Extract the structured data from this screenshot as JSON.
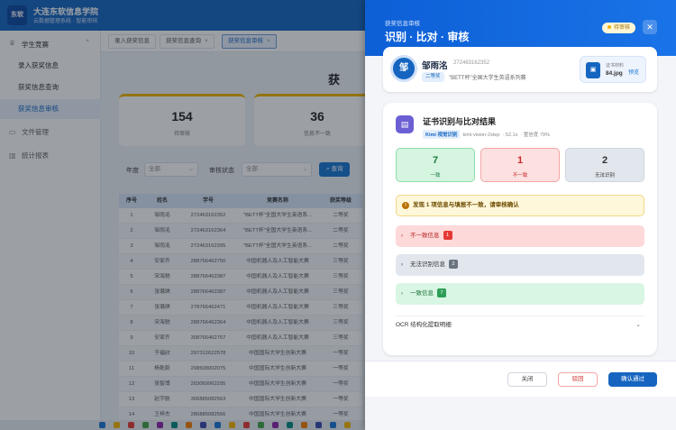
{
  "app": {
    "logo_text": "东软",
    "title": "大连东软信息学院",
    "subtitle": "云数据管理系统 · 智能审核"
  },
  "sidebar": {
    "group": {
      "label": "学生竞赛",
      "icon": "trophy-icon"
    },
    "items": [
      {
        "label": "录入获奖信息"
      },
      {
        "label": "获奖信息查询"
      },
      {
        "label": "获奖信息审核"
      }
    ],
    "groups2": [
      {
        "label": "文件管理",
        "icon": "folder-icon"
      },
      {
        "label": "统计报表",
        "icon": "chart-icon"
      }
    ]
  },
  "tabs": [
    {
      "label": "录入获奖信息",
      "closable": false
    },
    {
      "label": "获奖信息查询",
      "closable": true
    },
    {
      "label": "获奖信息审核",
      "closable": true
    }
  ],
  "page": {
    "title": "获"
  },
  "stats": [
    {
      "value": "154",
      "label": "待审核"
    },
    {
      "value": "36",
      "label": "信息不一致"
    }
  ],
  "filter": {
    "year_label": "年度",
    "year_value": "全部",
    "status_label": "审核状态",
    "status_value": "全部",
    "query_label": "查询"
  },
  "table": {
    "headers": [
      "序号",
      "姓名",
      "学号",
      "竞赛名称",
      "获奖等级"
    ],
    "rows": [
      [
        "1",
        "邹雨洺",
        "2724631623​52",
        "\"BETT杯\"全国大学生英语系...",
        "二等奖"
      ],
      [
        "2",
        "邹雨洺",
        "272463162364",
        "\"BETT杯\"全国大学生英语系...",
        "二等奖"
      ],
      [
        "3",
        "邹雨洺",
        "272463162395",
        "\"BETT杯\"全国大学生英语系...",
        "二等奖"
      ],
      [
        "4",
        "安家齐",
        "288766462750",
        "中国机器人及人工智能大赛",
        "三等奖"
      ],
      [
        "5",
        "宋海驰",
        "288766462387",
        "中国机器人及人工智能大赛",
        "三等奖"
      ],
      [
        "6",
        "张璐琪",
        "288766462387",
        "中国机器人及人工智能大赛",
        "三等奖"
      ],
      [
        "7",
        "张璐琪",
        "278766462471",
        "中国机器人及人工智能大赛",
        "三等奖"
      ],
      [
        "8",
        "宋海驰",
        "288766462364",
        "中国机器人及人工智能大赛",
        "三等奖"
      ],
      [
        "9",
        "安家齐",
        "308766462757",
        "中国机器人及人工智能大赛",
        "三等奖"
      ],
      [
        "10",
        "于福欣",
        "297312622578",
        "中国国际大学生创新大赛",
        "一等奖"
      ],
      [
        "11",
        "杨乾蔚",
        "298508002075",
        "中国国际大学生创新大赛",
        "一等奖"
      ],
      [
        "12",
        "张智博",
        "203069962295",
        "中国国际大学生创新大赛",
        "一等奖"
      ],
      [
        "13",
        "赵宇航",
        "306885082563",
        "中国国际大学生创新大赛",
        "一等奖"
      ],
      [
        "14",
        "王梓杰",
        "286885082566",
        "中国国际大学生创新大赛",
        "一等奖"
      ]
    ]
  },
  "drawer": {
    "kicker": "获奖信息审核",
    "title": "识别 · 比对 · 审核",
    "status_badge": "待审核",
    "close_icon": "close-icon",
    "student": {
      "avatar_text": "邹",
      "name": "邹雨洺",
      "id": "272463162352",
      "level": "二等奖",
      "competition": "\"BETT杯\"全国大学生英语系列赛"
    },
    "file": {
      "label": "证书材料",
      "name": "84.jpg",
      "preview_label": "预览"
    },
    "result": {
      "title": "证书识别与比对结果",
      "engine": "Kimi 视觉识别",
      "model": "kimi-vision-2step",
      "duration": "52.1s",
      "confidence": "置信度 79%",
      "summary": [
        {
          "value": "7",
          "label": "一致",
          "bg": "#d5f5e0",
          "border": "#8fdcaa",
          "color": "#1d7a3f"
        },
        {
          "value": "1",
          "label": "不一致",
          "bg": "#fde0e0",
          "border": "#f2a6a6",
          "color": "#c62828"
        },
        {
          "value": "2",
          "label": "无法识别",
          "bg": "#e2e7ee",
          "border": "#cfd6df",
          "color": "#333333"
        }
      ],
      "alert": "发现 1 项信息与填报不一致，请审核确认",
      "sections": [
        {
          "label": "不一致信息",
          "count": "1",
          "bg": "#fdd9d9",
          "color": "#b71c1c",
          "count_bg": "#e53935"
        },
        {
          "label": "无法识别信息",
          "count": "2",
          "bg": "#e2e7ee",
          "color": "#333333",
          "count_bg": "#6b7480"
        },
        {
          "label": "一致信息",
          "count": "7",
          "bg": "#d8f6e3",
          "color": "#1d6e3a",
          "count_bg": "#2e9e57"
        }
      ],
      "ocr_label": "OCR 结构化提取明细"
    },
    "buttons": {
      "close": "关闭",
      "reject": "驳回",
      "approve": "确认通过"
    }
  }
}
